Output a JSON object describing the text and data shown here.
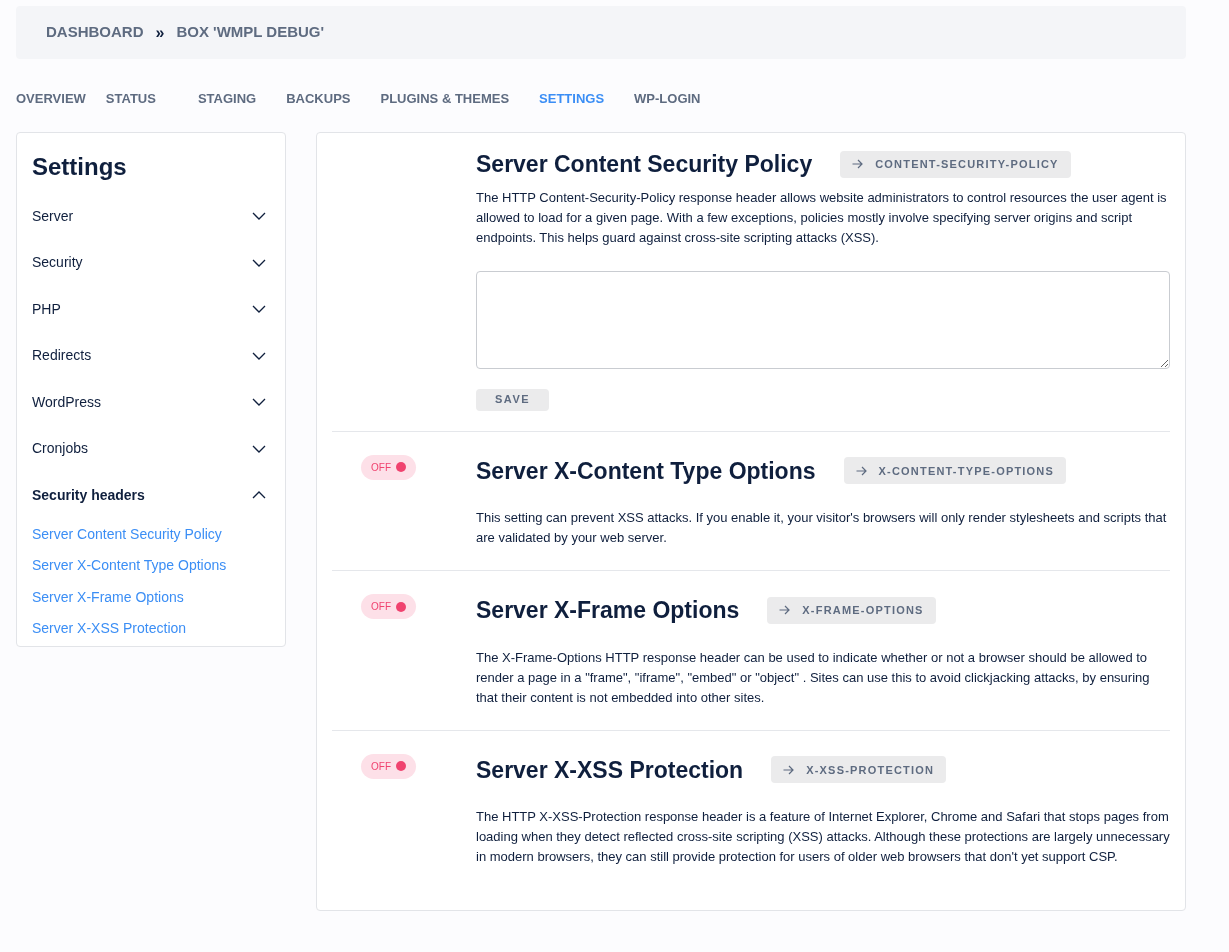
{
  "breadcrumb": {
    "items": [
      "DASHBOARD",
      "BOX 'WMPL DEBUG'"
    ],
    "separator": "»"
  },
  "tabs": [
    {
      "label": "OVERVIEW",
      "selected": false
    },
    {
      "label": "STATUS",
      "selected": false
    },
    {
      "label": "STAGING",
      "selected": false
    },
    {
      "label": "BACKUPS",
      "selected": false
    },
    {
      "label": "PLUGINS & THEMES",
      "selected": false
    },
    {
      "label": "SETTINGS",
      "selected": true
    },
    {
      "label": "WP-LOGIN",
      "selected": false
    }
  ],
  "sidebar": {
    "title": "Settings",
    "items": [
      {
        "label": "Server",
        "expanded": false
      },
      {
        "label": "Security",
        "expanded": false
      },
      {
        "label": "PHP",
        "expanded": false
      },
      {
        "label": "Redirects",
        "expanded": false
      },
      {
        "label": "WordPress",
        "expanded": false
      },
      {
        "label": "Cronjobs",
        "expanded": false
      },
      {
        "label": "Security headers",
        "expanded": true,
        "children": [
          {
            "label": "Server Content Security Policy"
          },
          {
            "label": "Server X-Content Type Options"
          },
          {
            "label": "Server X-Frame Options"
          },
          {
            "label": "Server X-XSS Protection"
          }
        ]
      }
    ]
  },
  "sections": [
    {
      "kind": "textarea",
      "title": "Server Content Security Policy",
      "header": "CONTENT-SECURITY-POLICY",
      "description": "The HTTP Content-Security-Policy response header allows website administrators to control resources the user agent is allowed to load for a given page. With a few exceptions, policies mostly involve specifying server origins and script endpoints. This helps guard against cross-site scripting attacks (XSS).",
      "button": "SAVE"
    },
    {
      "kind": "toggle",
      "toggle": {
        "label": "OFF",
        "on": false
      },
      "title": "Server X-Content Type Options",
      "header": "X-CONTENT-TYPE-OPTIONS",
      "description": "This setting can prevent XSS attacks. If you enable it, your visitor's browsers will only render stylesheets and scripts that are validated by your web server."
    },
    {
      "kind": "toggle",
      "toggle": {
        "label": "OFF",
        "on": false
      },
      "title": "Server X-Frame Options",
      "header": "X-FRAME-OPTIONS",
      "description": "The X-Frame-Options HTTP response header can be used to indicate whether or not a browser should be allowed to render a page in a \"frame\", \"iframe\", \"embed\" or \"object\" . Sites can use this to avoid clickjacking attacks, by ensuring that their content is not embedded into other sites."
    },
    {
      "kind": "toggle",
      "toggle": {
        "label": "OFF",
        "on": false
      },
      "title": "Server X-XSS Protection",
      "header": "X-XSS-PROTECTION",
      "description": "The HTTP X-XSS-Protection response header is a feature of Internet Explorer, Chrome and Safari that stops pages from loading when they detect reflected cross-site scripting (XSS) attacks. Although these protections are largely unnecessary in modern browsers, they can still provide protection for users of older web browsers that don't yet support CSP."
    }
  ]
}
